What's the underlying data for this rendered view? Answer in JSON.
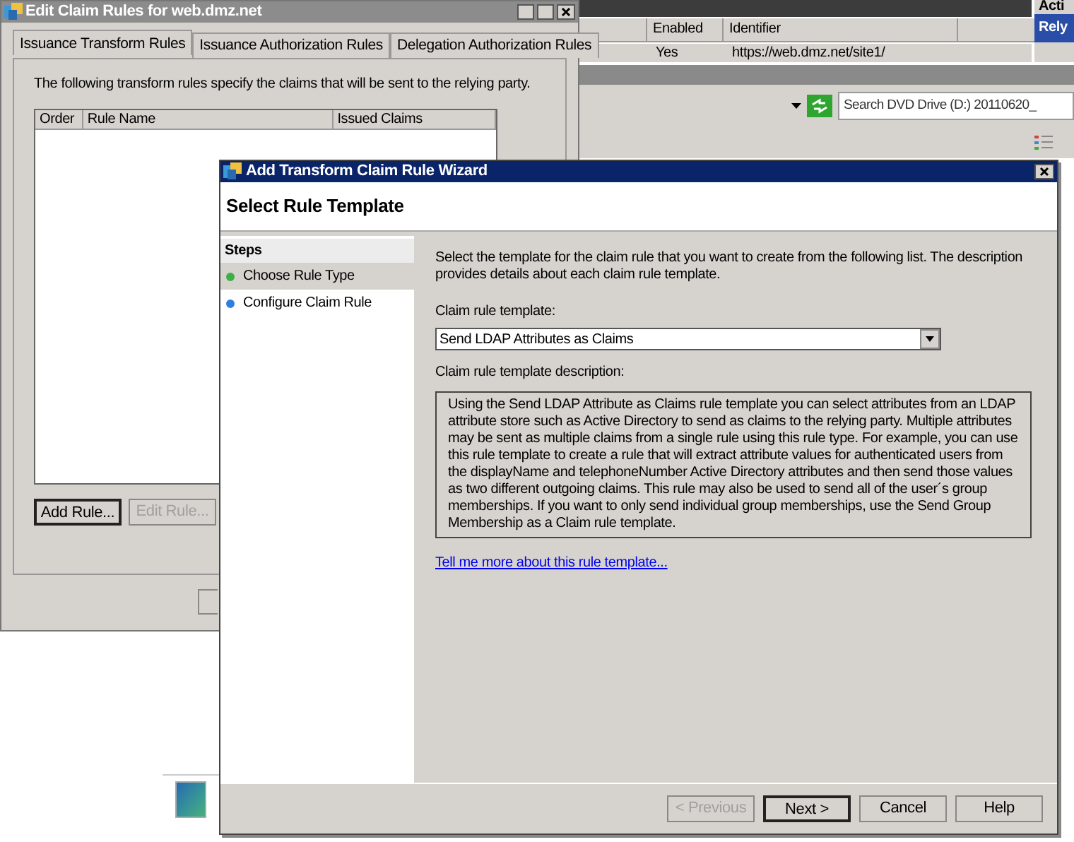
{
  "background_app": {
    "list_columns": [
      "Enabled",
      "Identifier"
    ],
    "list_row": [
      "Yes",
      "https://web.dmz.net/site1/"
    ],
    "actions_header": "Acti",
    "actions_item": "Rely",
    "search": {
      "placeholder": "Search DVD Drive (D:) 20110620_"
    }
  },
  "claim_rules_window": {
    "title": "Edit Claim Rules for web.dmz.net",
    "tabs": [
      {
        "label": "Issuance Transform Rules",
        "selected": true
      },
      {
        "label": "Issuance Authorization Rules",
        "selected": false
      },
      {
        "label": "Delegation Authorization Rules",
        "selected": false
      }
    ],
    "description": "The following transform rules specify the claims that will be sent to the relying party.",
    "columns": [
      "Order",
      "Rule Name",
      "Issued Claims"
    ],
    "buttons": [
      {
        "label": "Add Rule...",
        "disabled": false
      },
      {
        "label": "Edit Rule...",
        "disabled": true
      }
    ]
  },
  "wizard": {
    "title": "Add Transform Claim Rule Wizard",
    "page_title": "Select Rule Template",
    "steps_header": "Steps",
    "steps": [
      {
        "label": "Choose Rule Type",
        "selected": true,
        "color": "#3cb043"
      },
      {
        "label": "Configure Claim Rule",
        "selected": false,
        "color": "#2f7fe0"
      }
    ],
    "intro": "Select the template for the claim rule that you want to create from the following list. The description provides details about each claim rule template.",
    "template_label": "Claim rule template:",
    "template_value": "Send LDAP Attributes as Claims",
    "description_label": "Claim rule template description:",
    "description": "Using the Send LDAP Attribute as Claims rule template you can select attributes from an LDAP attribute store such as Active Directory to send as claims to the relying party. Multiple attributes may be sent as multiple claims from a single rule using this rule type. For example, you can use this rule template to create a rule that will extract attribute values for authenticated users from the displayName and telephoneNumber Active Directory attributes and then send those values as two different outgoing claims. This rule may also be used to send all of the user´s group memberships. If you want to only send individual group memberships, use the Send Group Membership as a Claim rule template.",
    "link": "Tell me more about this rule template...",
    "buttons": [
      {
        "label": "< Previous",
        "disabled": true,
        "default": false
      },
      {
        "label": "Next >",
        "disabled": false,
        "default": true
      },
      {
        "label": "Cancel",
        "disabled": false,
        "default": false
      },
      {
        "label": "Help",
        "disabled": false,
        "default": false
      }
    ]
  }
}
